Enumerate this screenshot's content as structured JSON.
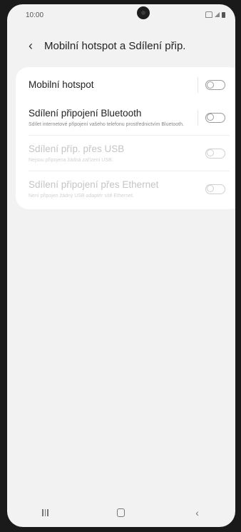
{
  "status_bar": {
    "time": "10:00"
  },
  "header": {
    "back_icon": "‹",
    "title": "Mobilní hotspot a Sdílení přip."
  },
  "settings": [
    {
      "title": "Mobilní hotspot",
      "subtitle": "",
      "enabled": true,
      "toggle_on": false,
      "has_divider": true
    },
    {
      "title": "Sdílení připojení Bluetooth",
      "subtitle": "Sdílet internetové připojení vašeho telefonu prostřednictvím Bluetooth.",
      "enabled": true,
      "toggle_on": false,
      "has_divider": true
    },
    {
      "title": "Sdílení příp. přes USB",
      "subtitle": "Nejsou připojena žádná zařízení USB.",
      "enabled": false,
      "toggle_on": false,
      "has_divider": false
    },
    {
      "title": "Sdílení připojení přes Ethernet",
      "subtitle": "Není připojen žádný USB adaptér sítě Ethernet.",
      "enabled": false,
      "toggle_on": false,
      "has_divider": false
    }
  ],
  "navbar": {
    "recents_icon": "recents-icon",
    "home_icon": "home-icon",
    "back_icon": "‹"
  },
  "colors": {
    "background": "#f2f2f2",
    "card": "#ffffff",
    "text_primary": "#222222",
    "text_disabled": "#c5c5c5"
  }
}
